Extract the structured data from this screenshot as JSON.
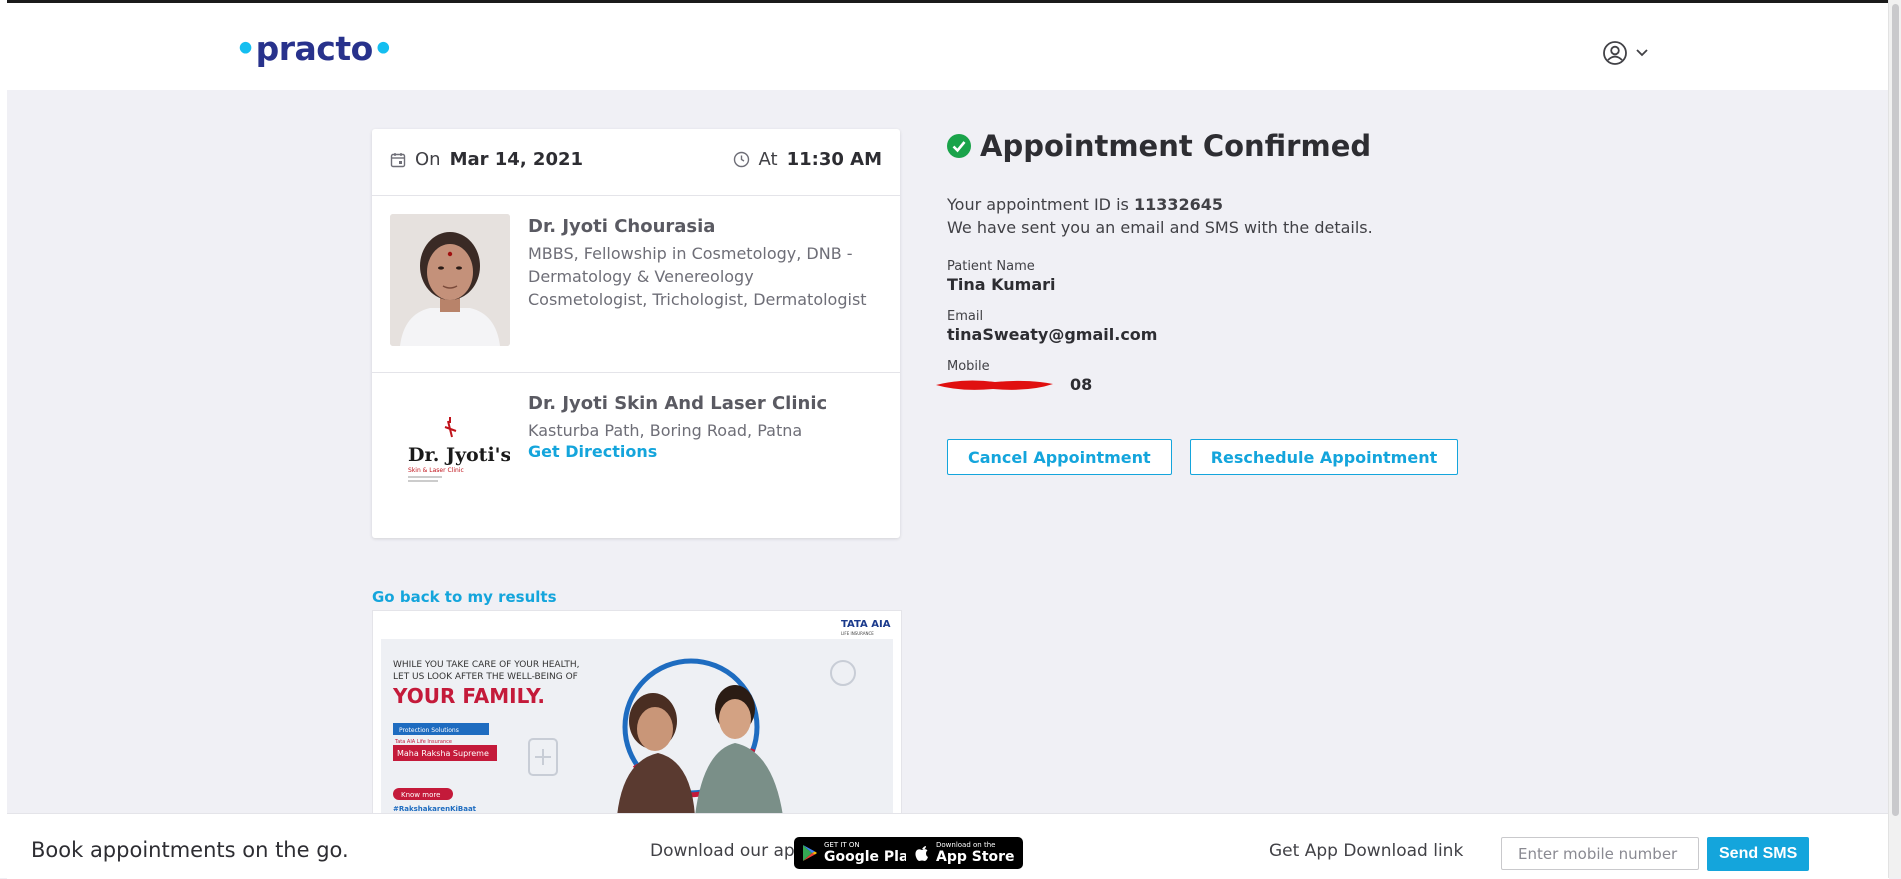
{
  "header": {
    "logo_text": "practo",
    "user_icon": "user-circle-icon",
    "dropdown_icon": "chevron-down-icon"
  },
  "appointment_card": {
    "date_prefix": "On",
    "date": "Mar 14, 2021",
    "time_prefix": "At",
    "time": "11:30 AM",
    "doctor": {
      "name": "Dr. Jyoti Chourasia",
      "qualifications": "MBBS, Fellowship in Cosmetology, DNB - Dermatology & Venereology",
      "specialties": "Cosmetologist, Trichologist, Dermatologist"
    },
    "clinic": {
      "logo_text": "Dr. Jyoti's",
      "logo_subtext": "Skin & Laser Clinic",
      "name": "Dr. Jyoti Skin And Laser Clinic",
      "address": "Kasturba Path, Boring Road, Patna",
      "directions_label": "Get Directions"
    }
  },
  "confirmation": {
    "title": "Appointment Confirmed",
    "id_prefix": "Your appointment ID is",
    "appointment_id": "11332645",
    "sent_message": "We have sent you an email and SMS with the details.",
    "patient_label": "Patient Name",
    "patient_name": "Tina Kumari",
    "email_label": "Email",
    "email": "tinaSweaty@gmail.com",
    "mobile_label": "Mobile",
    "mobile_visible": "08",
    "cancel_label": "Cancel Appointment",
    "reschedule_label": "Reschedule Appointment"
  },
  "back_link": "Go back to my results",
  "ad": {
    "brand": "TATA AIA",
    "brand_sub": "LIFE INSURANCE",
    "line1": "WHILE YOU TAKE CARE OF YOUR HEALTH,",
    "line2": "LET US LOOK AFTER THE WELL-BEING OF",
    "headline": "YOUR FAMILY.",
    "badge_top": "Protection Solutions",
    "badge_company": "Tata AIA Life Insurance",
    "badge_product": "Maha Raksha Supreme",
    "cta": "Know more",
    "hashtag": "#RakshakarenKiBaat"
  },
  "footer": {
    "tagline": "Book appointments on the go.",
    "download_label": "Download our app",
    "google_small": "GET IT ON",
    "google_big": "Google Play",
    "apple_small": "Download on the",
    "apple_big": "App Store",
    "get_link_label": "Get App Download link",
    "mobile_placeholder": "Enter mobile number",
    "send_label": "Send SMS"
  },
  "colors": {
    "accent": "#14a5dc",
    "brand_blue": "#28328c",
    "success": "#1aa34a",
    "background": "#f0f0f5"
  }
}
